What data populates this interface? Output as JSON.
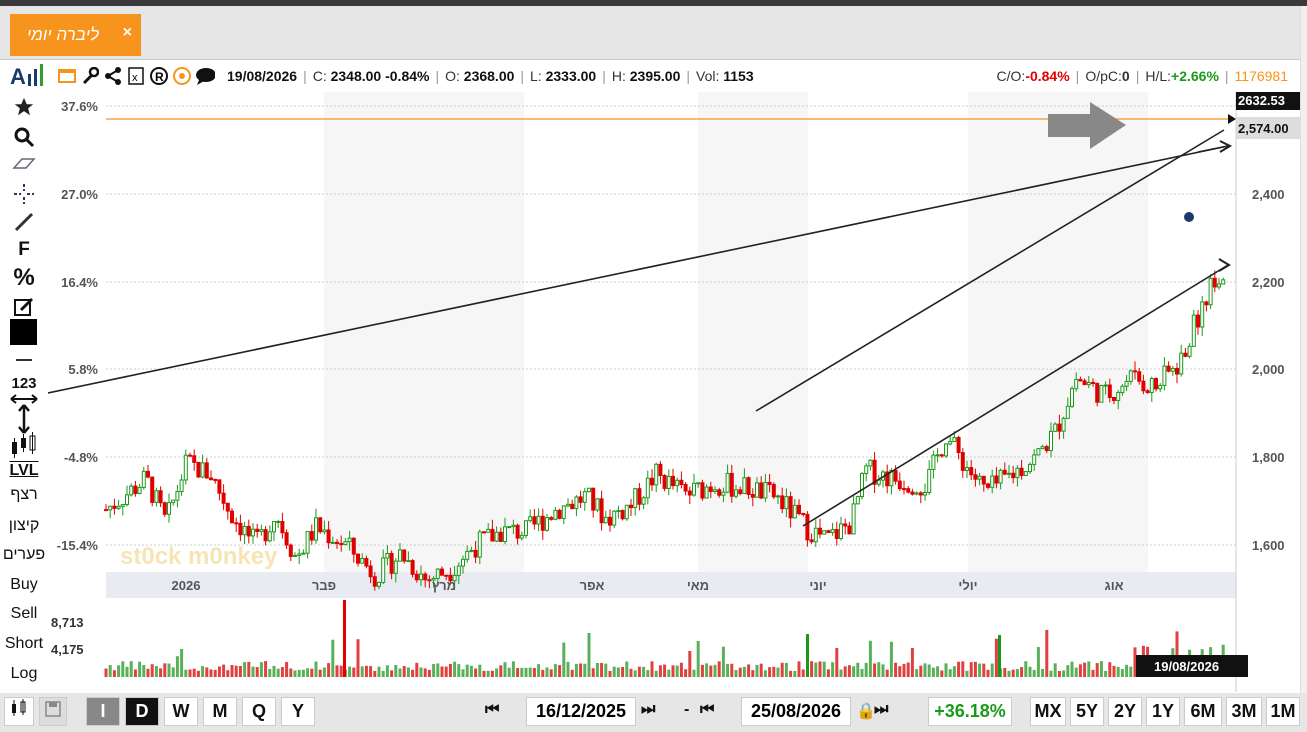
{
  "tab": {
    "title": "ליברה יומי",
    "close": "×"
  },
  "info": {
    "date": "19/08/2026",
    "close_label": "C:",
    "close": "2348.00",
    "change": "-0.84%",
    "open_label": "O:",
    "open": "2368.00",
    "low_label": "L:",
    "low": "2333.00",
    "high_label": "H:",
    "high": "2395.00",
    "vol_label": "Vol:",
    "vol": "1153",
    "co_label": "C/O:",
    "co": "-0.84%",
    "opc_label": "O/pC:",
    "opc": "0",
    "hl_label": "H/L:",
    "hl": "+2.66%",
    "id": "1176981"
  },
  "toolbar_icons": [
    "logo-icon",
    "window-icon",
    "wrench-icon",
    "share-icon",
    "excel-icon",
    "registered-icon",
    "target-icon",
    "comment-icon"
  ],
  "sidebar": {
    "pct": "%",
    "f": "F",
    "num": "123",
    "lvl": "LVL",
    "continuous": "רצף",
    "extreme": "קיצון",
    "gaps": "פערים",
    "buy": "Buy",
    "sell": "Sell",
    "short": "Short",
    "log": "Log"
  },
  "axis": {
    "left_pct": [
      "37.6%",
      "27.0%",
      "16.4%",
      "5.8%",
      "-4.8%",
      "-15.4%"
    ],
    "right_price": [
      "2,400",
      "2,200",
      "2,000",
      "1,800",
      "1,600"
    ],
    "months": [
      "2026",
      "פבר",
      "מרץ",
      "אפר",
      "מאי",
      "יוני",
      "יולי",
      "אוג"
    ],
    "last_price": "2632.53",
    "line_price": "2,574.00",
    "vol_labels": [
      "8,713",
      "4,175"
    ],
    "cursor_date": "19/08/2026",
    "watermark": "st0ck m0nkey"
  },
  "bottom": {
    "periods": [
      "I",
      "D",
      "W",
      "M",
      "Q",
      "Y"
    ],
    "date_from": "16/12/2025",
    "dash": "-",
    "date_to": "25/08/2026",
    "change": "+36.18%",
    "ranges": [
      "MX",
      "5Y",
      "2Y",
      "1Y",
      "6M",
      "3M",
      "1M"
    ]
  },
  "colors": {
    "accent": "#f7941d",
    "up": "#1a9a1a",
    "down": "#e00000"
  }
}
